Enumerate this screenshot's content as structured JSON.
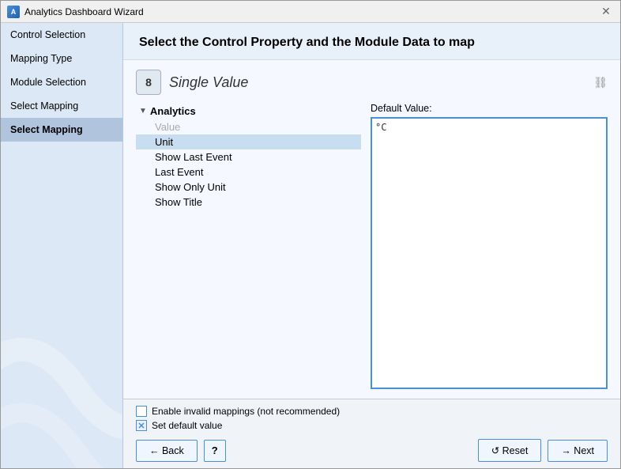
{
  "window": {
    "title": "Analytics Dashboard Wizard",
    "icon": "A"
  },
  "sidebar": {
    "items": [
      {
        "label": "Control Selection",
        "active": false
      },
      {
        "label": "Mapping Type",
        "active": false
      },
      {
        "label": "Module Selection",
        "active": false
      },
      {
        "label": "Select Mapping",
        "active": false
      },
      {
        "label": "Select Mapping",
        "active": true
      }
    ]
  },
  "header": {
    "title": "Select the Control Property and the Module Data to map"
  },
  "widget": {
    "icon": "8",
    "title": "Single Value"
  },
  "tree": {
    "root": "Analytics",
    "items": [
      {
        "label": "Value",
        "disabled": true
      },
      {
        "label": "Unit",
        "selected": true
      },
      {
        "label": "Show Last Event"
      },
      {
        "label": "Last Event"
      },
      {
        "label": "Show Only Unit"
      },
      {
        "label": "Show Title"
      }
    ]
  },
  "right_panel": {
    "label": "Default Value:",
    "value": "°C"
  },
  "footer": {
    "checkbox1_label": "Enable invalid mappings (not recommended)",
    "checkbox1_checked": false,
    "checkbox2_label": "Set default value",
    "checkbox2_checked": true,
    "back_label": "← Back",
    "help_label": "?",
    "reset_label": "↺ Reset",
    "next_label": "→ Next"
  }
}
